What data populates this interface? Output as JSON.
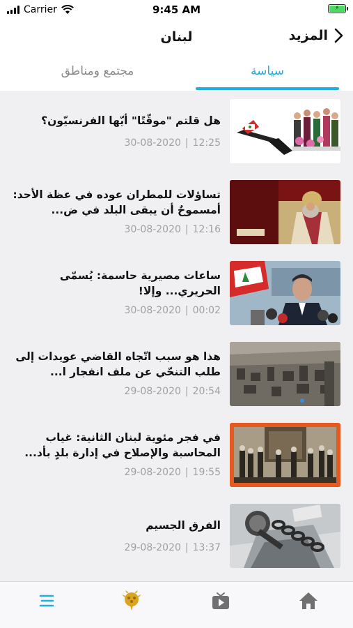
{
  "status_bar": {
    "carrier": "Carrier",
    "time": "9:45 AM",
    "battery_color": "#4cd964"
  },
  "nav": {
    "title": "لبنان",
    "more_label": "المزيد"
  },
  "tabs": [
    {
      "label": "سياسة",
      "active": true
    },
    {
      "label": "مجتمع ومناطق",
      "active": false
    }
  ],
  "accent_color": "#1faee0",
  "articles": [
    {
      "title": "هل قلتم \"موقّتًا\" أيّها الفرنسيّون؟",
      "time": "12:25",
      "date": "30-08-2020"
    },
    {
      "title": "تساؤلات للمطران عوده في عظة الأحد: أمسموحٌ أن يبقى البلد في ض...",
      "time": "12:16",
      "date": "30-08-2020"
    },
    {
      "title": "ساعات مصيرية حاسمة: يُسمّى الحريري... وإلا!",
      "time": "00:02",
      "date": "30-08-2020"
    },
    {
      "title": "هذا هو سبب اتّجاه القاضي عويدات إلى طلب التنحّي عن ملف انفجار ا...",
      "time": "20:54",
      "date": "29-08-2020"
    },
    {
      "title": "في فجر مئوية لبنان الثانية: غياب المحاسبة والإصلاح في إدارة بلدٍ بأد...",
      "time": "19:55",
      "date": "29-08-2020"
    },
    {
      "title": "الفرق الجسيم",
      "time": "13:37",
      "date": "29-08-2020"
    }
  ],
  "tab_bar": {
    "items": [
      {
        "icon": "menu-icon",
        "active": true
      },
      {
        "icon": "cedar-logo-icon",
        "active": false
      },
      {
        "icon": "tv-play-icon",
        "active": false
      },
      {
        "icon": "home-icon",
        "active": false
      }
    ]
  }
}
